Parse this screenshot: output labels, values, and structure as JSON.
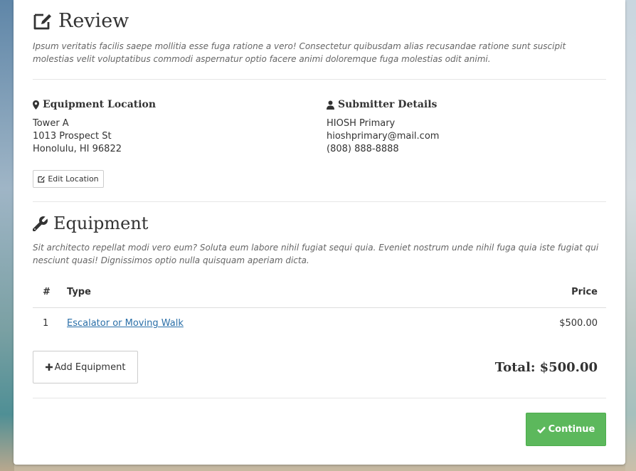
{
  "review": {
    "title": "Review",
    "description": "Ipsum veritatis facilis saepe mollitia esse fuga ratione a vero! Consectetur quibusdam alias recusandae ratione sunt suscipit molestias velit voluptatibus commodi aspernatur optio facere animi doloremque fuga molestias odit animi."
  },
  "location": {
    "heading": "Equipment Location",
    "lines": [
      "Tower A",
      "1013 Prospect St",
      "Honolulu, HI 96822"
    ],
    "edit_label": "Edit Location"
  },
  "submitter": {
    "heading": "Submitter Details",
    "lines": [
      "HIOSH Primary",
      "hioshprimary@mail.com",
      "(808) 888-8888"
    ]
  },
  "equipment": {
    "title": "Equipment",
    "description": "Sit architecto repellat modi vero eum? Soluta eum labore nihil fugiat sequi quia. Eveniet nostrum unde nihil fuga quia iste fugiat qui nesciunt quasi! Dignissimos optio nulla quisquam aperiam dicta.",
    "columns": [
      "#",
      "Type",
      "Price"
    ],
    "rows": [
      {
        "num": "1",
        "type": "Escalator or Moving Walk",
        "price": "$500.00"
      }
    ],
    "add_label": "Add Equipment",
    "total_label": "Total:",
    "total_value": "$500.00"
  },
  "actions": {
    "continue_label": "Continue"
  },
  "icons": {
    "review": "edit-icon",
    "location": "map-marker-icon",
    "submitter": "user-icon",
    "equipment": "wrench-icon",
    "add": "plus-icon",
    "continue": "check-icon"
  },
  "colors": {
    "link": "#2a6fa8",
    "success": "#5cb85c"
  }
}
